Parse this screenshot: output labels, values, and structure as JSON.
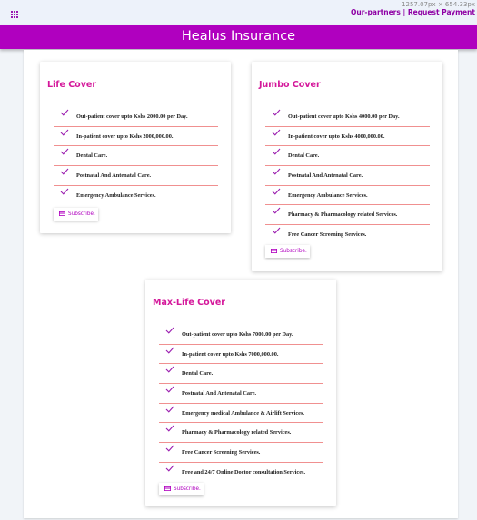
{
  "topbar": {
    "dims": "1257.07px × 654.33px",
    "links": {
      "partners": "Our-partners",
      "separator": " | ",
      "payment": "Request Payment"
    }
  },
  "header": {
    "title": "Healus Insurance"
  },
  "colors": {
    "brand": "#b000bf",
    "title": "#d4179a",
    "divider": "#f09090",
    "check": "#9b1fb0"
  },
  "icons": {
    "menu": "grid-icon",
    "feature": "check-icon",
    "subscribe": "card-icon"
  },
  "cards": [
    {
      "title": "Life Cover",
      "features": [
        "Out-patient cover upto Kshs 2000.00 per Day.",
        "In-patient cover upto Kshs 2000,000.00.",
        "Dental Care.",
        "Postnatal And Antenatal Care.",
        "Emergency Ambulance Services."
      ],
      "button": "Subscribe."
    },
    {
      "title": "Jumbo Cover",
      "features": [
        "Out-patient cover upto Kshs 4000.00 per Day.",
        "In-patient cover upto Kshs 4000,000.00.",
        "Dental Care.",
        "Postnatal And Antenatal Care.",
        "Emergency Ambulance Services.",
        "Pharmacy & Pharmacology related Services.",
        "Free Cancer Screening Services."
      ],
      "button": "Subscribe."
    },
    {
      "title": "Max-Life Cover",
      "features": [
        "Out-patient cover upto Kshs 7000.00 per Day.",
        "In-patient cover upto Kshs 7000,000.00.",
        "Dental Care.",
        "Postnatal And Antenatal Care.",
        "Emergency medical Ambulance & Airlift Services.",
        "Pharmacy & Pharmacology related Services.",
        "Free Cancer Screening Services.",
        "Free and 24/7 Online Doctor consultation Services."
      ],
      "button": "Subscribe."
    }
  ]
}
